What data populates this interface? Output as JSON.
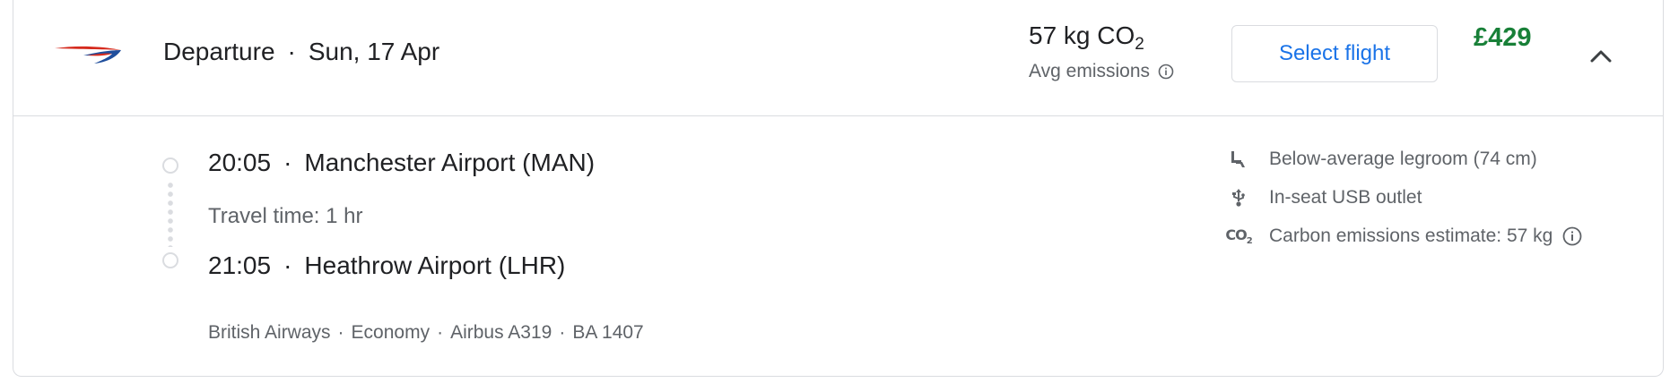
{
  "header": {
    "airline_logo": "british-airways-logo",
    "label": "Departure",
    "separator": "·",
    "date": "Sun, 17 Apr",
    "emissions_main": "57 kg CO",
    "emissions_sub": "2",
    "emissions_label": "Avg emissions",
    "select_label": "Select flight",
    "price": "£429",
    "collapse_icon": "chevron-up-icon"
  },
  "itinerary": {
    "departure": {
      "time": "20:05",
      "airport": "Manchester Airport (MAN)"
    },
    "travel_time": "Travel time: 1 hr",
    "arrival": {
      "time": "21:05",
      "airport": "Heathrow Airport (LHR)"
    },
    "separator": "·"
  },
  "details": {
    "airline": "British Airways",
    "cabin": "Economy",
    "aircraft": "Airbus A319",
    "flight_number": "BA 1407",
    "separator": "·"
  },
  "amenities": [
    {
      "icon": "legroom-seat-icon",
      "text": "Below-average legroom (74 cm)"
    },
    {
      "icon": "usb-icon",
      "text": "In-seat USB outlet"
    },
    {
      "icon": "co2-icon",
      "text": "Carbon emissions estimate: 57 kg",
      "icon_text": "CO",
      "icon_sub": "2"
    }
  ],
  "colors": {
    "price": "#188038",
    "accent": "#1a73e8",
    "muted": "#5f6368",
    "border": "#dadce0"
  }
}
